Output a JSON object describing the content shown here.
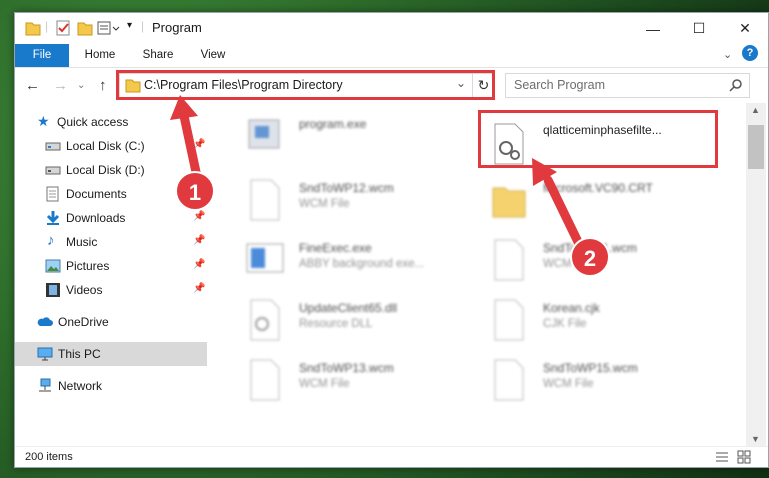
{
  "window": {
    "title": "Program"
  },
  "window_controls": {
    "minimize": "—",
    "maximize": "☐",
    "close": "✕"
  },
  "ribbon": {
    "tabs": [
      "File",
      "Home",
      "Share",
      "View"
    ],
    "help": "?"
  },
  "nav": {
    "back": "←",
    "forward": "→",
    "up": "↑",
    "address": "C:\\Program Files\\Program Directory",
    "search_placeholder": "Search Program",
    "refresh": "↻",
    "dropdown": "⌄"
  },
  "sidebar": {
    "items": [
      {
        "label": "Quick access",
        "icon": "star-icon"
      },
      {
        "label": "Local Disk (C:)",
        "icon": "drive-icon",
        "pinned": true
      },
      {
        "label": "Local Disk (D:)",
        "icon": "drive-icon"
      },
      {
        "label": "Documents",
        "icon": "documents-icon",
        "pinned": true
      },
      {
        "label": "Downloads",
        "icon": "downloads-icon",
        "pinned": true
      },
      {
        "label": "Music",
        "icon": "music-icon",
        "pinned": true
      },
      {
        "label": "Pictures",
        "icon": "pictures-icon",
        "pinned": true
      },
      {
        "label": "Videos",
        "icon": "videos-icon",
        "pinned": true
      },
      {
        "label": "OneDrive",
        "icon": "cloud-icon"
      },
      {
        "label": "This PC",
        "icon": "computer-icon",
        "selected": true
      },
      {
        "label": "Network",
        "icon": "network-icon"
      }
    ]
  },
  "files": [
    {
      "name": "program.exe",
      "sub": ""
    },
    {
      "name": "qlatticeminphasefilte...",
      "sub": ""
    },
    {
      "name": "SndToWP12.wcm",
      "sub": "WCM File"
    },
    {
      "name": "Microsoft.VC90.CRT",
      "sub": ""
    },
    {
      "name": "FineExec.exe",
      "sub": "ABBY background exe..."
    },
    {
      "name": "SndToWP11.wcm",
      "sub": "WCM File"
    },
    {
      "name": "UpdateClient65.dll",
      "sub": "Resource DLL"
    },
    {
      "name": "Korean.cjk",
      "sub": "CJK File"
    },
    {
      "name": "SndToWP13.wcm",
      "sub": "WCM File"
    },
    {
      "name": "SndToWP15.wcm",
      "sub": "WCM File"
    }
  ],
  "status": {
    "count": "200 items"
  },
  "annotations": {
    "step1": "1",
    "step2": "2"
  },
  "colors": {
    "accent": "#1979ca",
    "highlight": "#e0393e"
  }
}
